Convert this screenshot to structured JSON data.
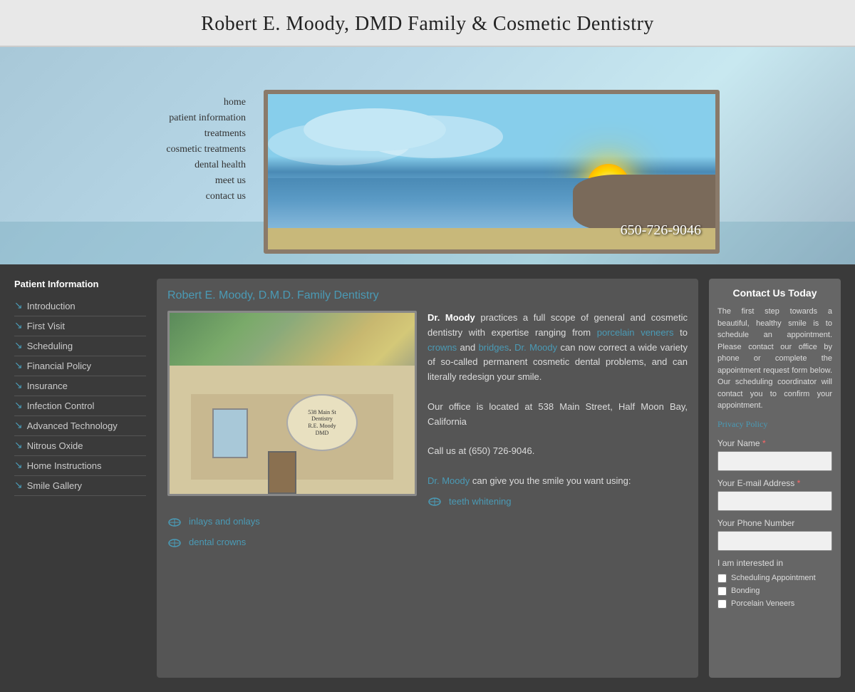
{
  "header": {
    "title": "Robert E. Moody, DMD Family & Cosmetic Dentistry"
  },
  "nav": {
    "phone": "650-726-9046",
    "items": [
      {
        "label": "home",
        "href": "#"
      },
      {
        "label": "patient information",
        "href": "#"
      },
      {
        "label": "treatments",
        "href": "#"
      },
      {
        "label": "cosmetic treatments",
        "href": "#"
      },
      {
        "label": "dental health",
        "href": "#"
      },
      {
        "label": "meet us",
        "href": "#"
      },
      {
        "label": "contact us",
        "href": "#"
      }
    ]
  },
  "sidebar": {
    "section_title": "Patient Information",
    "items": [
      {
        "label": "Introduction"
      },
      {
        "label": "First Visit"
      },
      {
        "label": "Scheduling"
      },
      {
        "label": "Financial Policy"
      },
      {
        "label": "Insurance"
      },
      {
        "label": "Infection Control"
      },
      {
        "label": "Advanced Technology"
      },
      {
        "label": "Nitrous Oxide"
      },
      {
        "label": "Home Instructions"
      },
      {
        "label": "Smile Gallery"
      }
    ]
  },
  "content": {
    "page_title": "Robert E. Moody, D.M.D. Family Dentistry",
    "intro_bold": "Dr. Moody",
    "intro_text": " practices a full scope of general and cosmetic dentistry with expertise ranging from ",
    "link1": "porcelain veneers",
    "text2": " to ",
    "link2": "crowns",
    "text3": " and ",
    "link3": "bridges",
    "text4": ". ",
    "link4": "Dr. Moody",
    "text5": " can now correct a wide variety of so-called permanent cosmetic dental problems, and can literally redesign your smile.",
    "address_text": "Our office is located at 538 Main Street, Half Moon Bay, California",
    "phone_text": "Call us at (650) 726-9046.",
    "smile_intro_link": "Dr. Moody",
    "smile_intro_text": " can give you the smile you want using:",
    "sign_text": "538 MAIN STREET\nDENTISTRY\nROBERT E. MOODY, DMD",
    "list_items": [
      {
        "label": "teeth whitening",
        "href": "#"
      },
      {
        "label": "inlays and onlays",
        "href": "#"
      },
      {
        "label": "dental crowns",
        "href": "#"
      }
    ]
  },
  "contact": {
    "title": "Contact Us Today",
    "description": "The first step towards a beautiful, healthy smile is to schedule an appointment. Please contact our office by phone or complete the appointment request form below. Our scheduling coordinator will contact you to confirm your appointment.",
    "privacy_label": "Privacy Policy",
    "name_label": "Your Name",
    "name_required": "*",
    "email_label": "Your E-mail Address",
    "email_required": "*",
    "phone_label": "Your Phone Number",
    "interested_label": "I am interested in",
    "checkboxes": [
      {
        "label": "Scheduling Appointment"
      },
      {
        "label": "Bonding"
      },
      {
        "label": "Porcelain Veneers"
      }
    ]
  }
}
